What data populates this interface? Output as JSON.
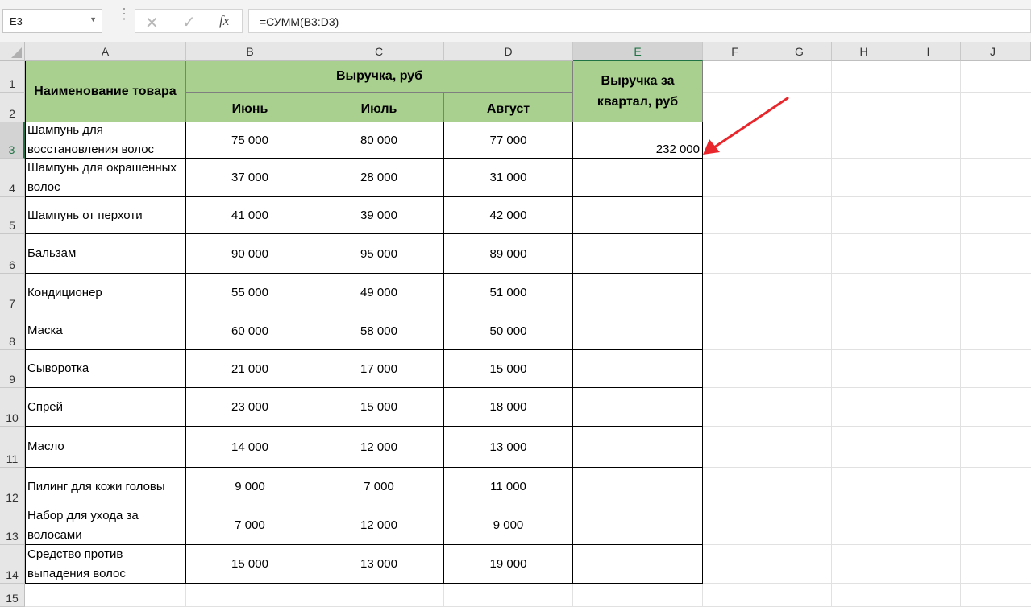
{
  "formula_bar": {
    "name_box": "E3",
    "formula": "=СУММ(B3:D3)",
    "fx_label": "fx"
  },
  "columns": [
    "A",
    "B",
    "C",
    "D",
    "E",
    "F",
    "G",
    "H",
    "I",
    "J"
  ],
  "rows": [
    "1",
    "2",
    "3",
    "4",
    "5",
    "6",
    "7",
    "8",
    "9",
    "10",
    "11",
    "12",
    "13",
    "14",
    "15"
  ],
  "table": {
    "header_name": "Наименование товара",
    "header_revenue": "Выручка, руб",
    "header_months": [
      "Июнь",
      "Июль",
      "Август"
    ],
    "header_quarter": "Выручка за квартал, руб",
    "rows": [
      {
        "name": "Шампунь для восстановления волос",
        "values": [
          "75 000",
          "80 000",
          "77 000"
        ],
        "total": "232 000"
      },
      {
        "name": "Шампунь для окрашенных волос",
        "values": [
          "37 000",
          "28 000",
          "31 000"
        ],
        "total": ""
      },
      {
        "name": "Шампунь от перхоти",
        "values": [
          "41 000",
          "39 000",
          "42 000"
        ],
        "total": ""
      },
      {
        "name": "Бальзам",
        "values": [
          "90 000",
          "95 000",
          "89 000"
        ],
        "total": ""
      },
      {
        "name": "Кондиционер",
        "values": [
          "55 000",
          "49 000",
          "51 000"
        ],
        "total": ""
      },
      {
        "name": "Маска",
        "values": [
          "60 000",
          "58 000",
          "50 000"
        ],
        "total": ""
      },
      {
        "name": "Сыворотка",
        "values": [
          "21 000",
          "17 000",
          "15 000"
        ],
        "total": ""
      },
      {
        "name": "Спрей",
        "values": [
          "23 000",
          "15 000",
          "18 000"
        ],
        "total": ""
      },
      {
        "name": "Масло",
        "values": [
          "14 000",
          "12 000",
          "13 000"
        ],
        "total": ""
      },
      {
        "name": "Пилинг для кожи головы",
        "values": [
          "9 000",
          "7 000",
          "11 000"
        ],
        "total": ""
      },
      {
        "name": "Набор для ухода за волосами",
        "values": [
          "7 000",
          "12 000",
          "9 000"
        ],
        "total": ""
      },
      {
        "name": "Средство против выпадения волос",
        "values": [
          "15 000",
          "13 000",
          "19 000"
        ],
        "total": ""
      }
    ]
  },
  "colors": {
    "header_fill": "#a9d08e",
    "arrow": "#e8262b",
    "selection": "#217346"
  }
}
